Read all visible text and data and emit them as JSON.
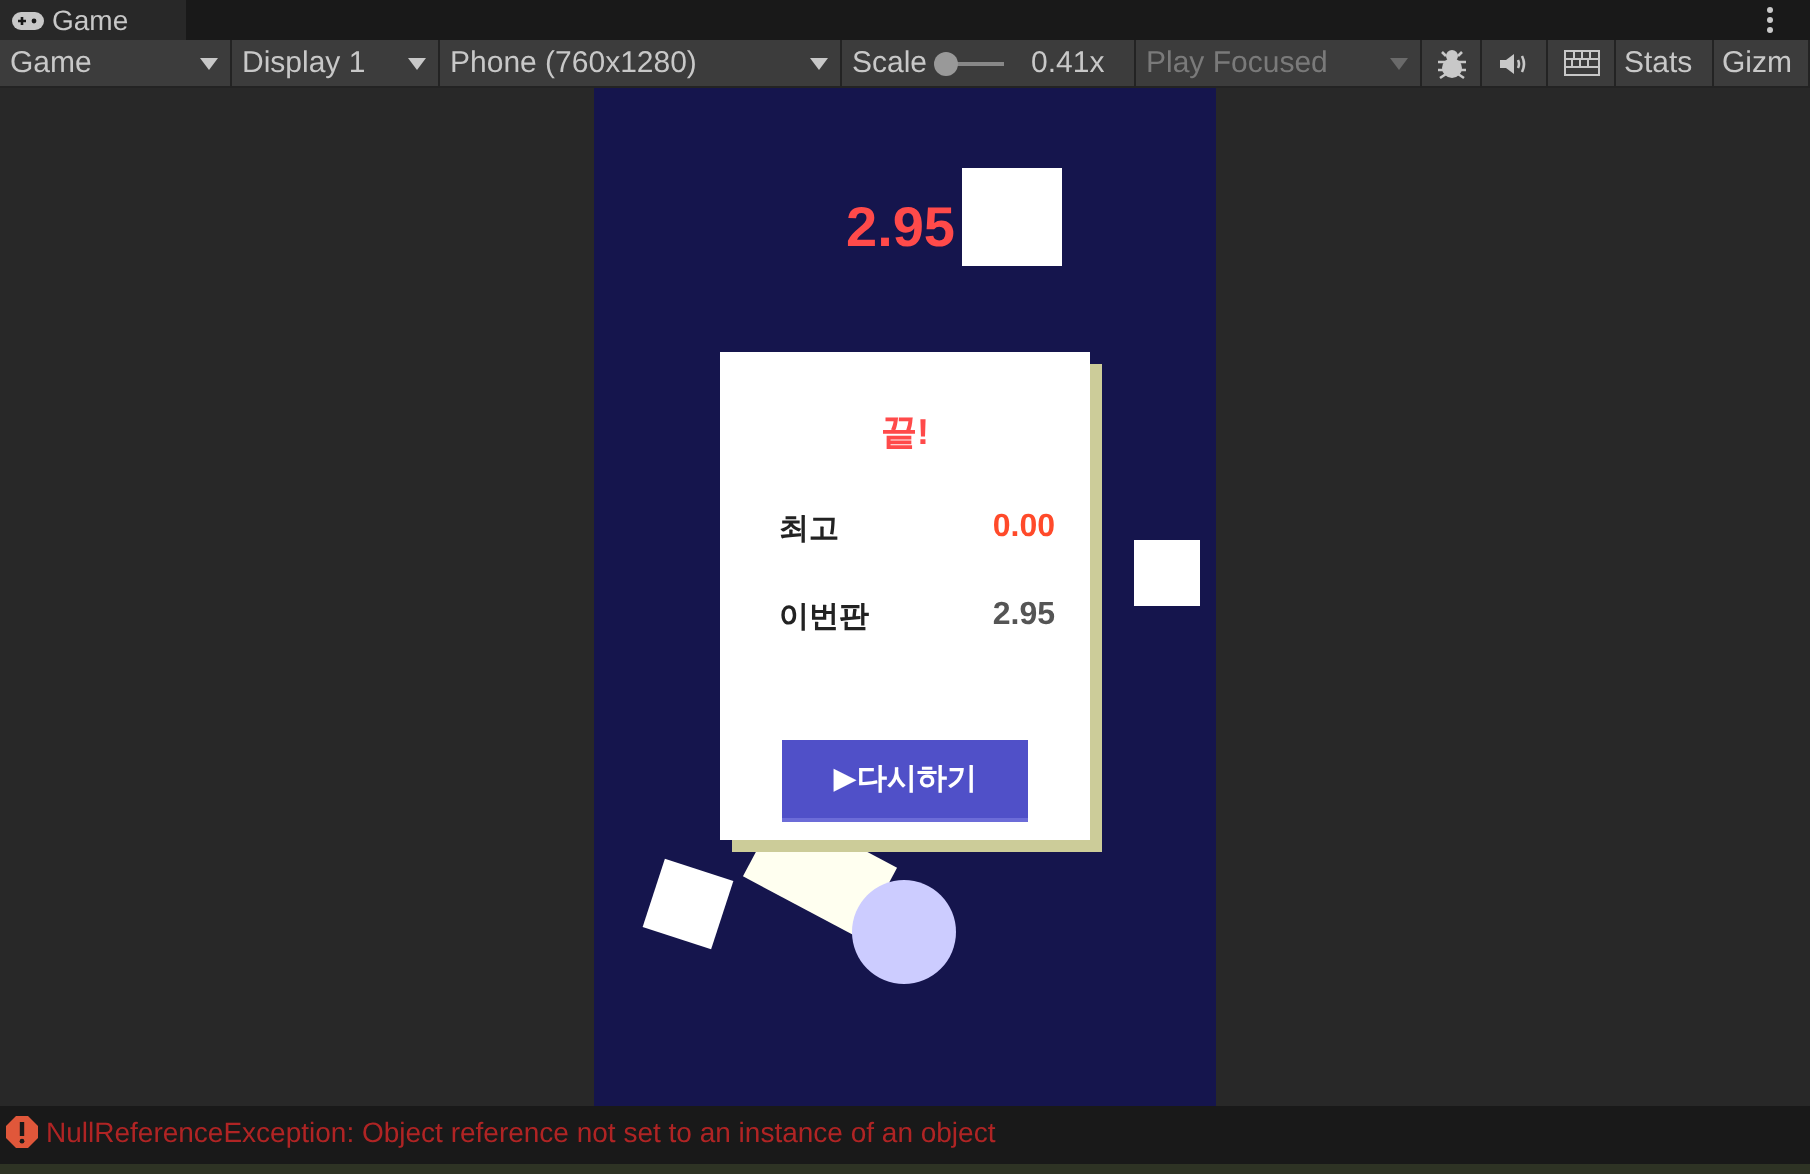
{
  "tab": {
    "label": "Game",
    "selected": true
  },
  "toolbar": [
    {
      "kind": "dropdown",
      "label": "Game",
      "disabled": false
    },
    {
      "kind": "dropdown",
      "label": "Display 1",
      "disabled": false
    },
    {
      "kind": "dropdown",
      "label": "Phone (760x1280)",
      "disabled": false
    },
    {
      "kind": "slider",
      "label": "Scale",
      "level": 0.05,
      "reading": "0.41x"
    },
    {
      "kind": "dropdown",
      "label": "Play Focused",
      "disabled": true
    },
    {
      "kind": "bug"
    },
    {
      "kind": "sound"
    },
    {
      "kind": "keyboard"
    },
    {
      "kind": "button",
      "label": "Stats"
    },
    {
      "kind": "button",
      "label": "Gizm"
    }
  ],
  "game": {
    "score": "2.95",
    "panel": {
      "title": "끝!",
      "rows": [
        {
          "label": "최고",
          "value": "0.00",
          "highlight": true
        },
        {
          "label": "이번판",
          "value": "2.95",
          "highlight": false
        }
      ],
      "button": "▶다시하기"
    }
  },
  "status_bar": {
    "message": "NullReferenceException: Object reference not set to an instance of an object"
  }
}
